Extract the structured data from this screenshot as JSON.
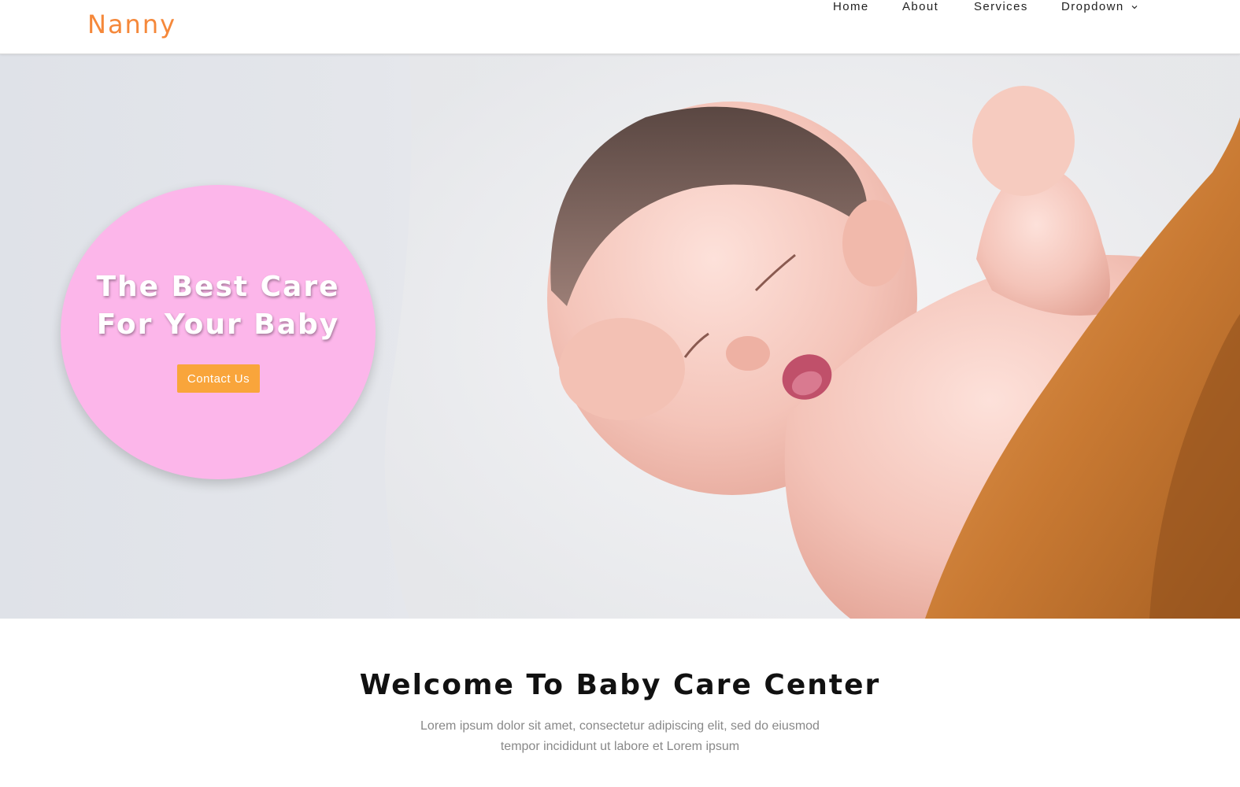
{
  "brand": {
    "logo": "Nanny",
    "accent": "#f5883a"
  },
  "nav": {
    "items": [
      {
        "label": "Home"
      },
      {
        "label": "About"
      },
      {
        "label": "Services"
      },
      {
        "label": "Dropdown",
        "icon": "chevron-down-icon"
      }
    ]
  },
  "hero": {
    "title_line1": "The Best Care",
    "title_line2": "For Your Baby",
    "cta_label": "Contact Us",
    "circle_color": "#fcb6ea",
    "cta_color": "#f9a53b"
  },
  "welcome": {
    "title": "Welcome To Baby Care Center",
    "text": "Lorem ipsum dolor sit amet, consectetur adipiscing elit, sed do eiusmod tempor incididunt ut labore et Lorem ipsum"
  }
}
